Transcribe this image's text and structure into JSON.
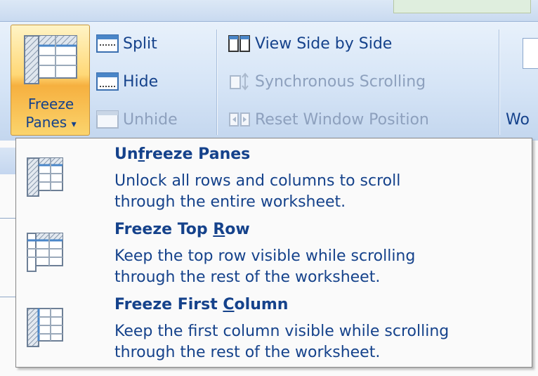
{
  "ribbon": {
    "freeze_panes": {
      "label_line1": "Freeze",
      "label_line2": "Panes",
      "arrow": "▾"
    },
    "window_group": [
      {
        "label": "Split",
        "icon": "split-icon",
        "enabled": true
      },
      {
        "label": "Hide",
        "icon": "hide-icon",
        "enabled": true
      },
      {
        "label": "Unhide",
        "icon": "unhide-icon",
        "enabled": false
      }
    ],
    "compare_group": [
      {
        "label": "View Side by Side",
        "icon": "view-side-by-side-icon",
        "enabled": true
      },
      {
        "label": "Synchronous Scrolling",
        "icon": "synchronous-scrolling-icon",
        "enabled": false
      },
      {
        "label": "Reset Window Position",
        "icon": "reset-window-position-icon",
        "enabled": false
      }
    ],
    "cut_off_label": "Wo"
  },
  "freeze_menu": {
    "items": [
      {
        "title_pre": "Un",
        "title_key": "f",
        "title_post": "reeze Panes",
        "description": "Unlock all rows and columns to scroll\nthrough the entire worksheet.",
        "icon": "unfreeze-panes-icon"
      },
      {
        "title_pre": "Freeze Top ",
        "title_key": "R",
        "title_post": "ow",
        "description": "Keep the top row visible while scrolling\nthrough the rest of the worksheet.",
        "icon": "freeze-top-row-icon"
      },
      {
        "title_pre": "Freeze First ",
        "title_key": "C",
        "title_post": "olumn",
        "description": "Keep the first column visible while scrolling\nthrough the rest of the worksheet.",
        "icon": "freeze-first-column-icon"
      }
    ]
  },
  "colors": {
    "text_blue": "#15428b",
    "disabled_gray": "#8da0bd",
    "hover_orange": "#f6b03f",
    "ribbon_blue": "#d5e4f6"
  }
}
